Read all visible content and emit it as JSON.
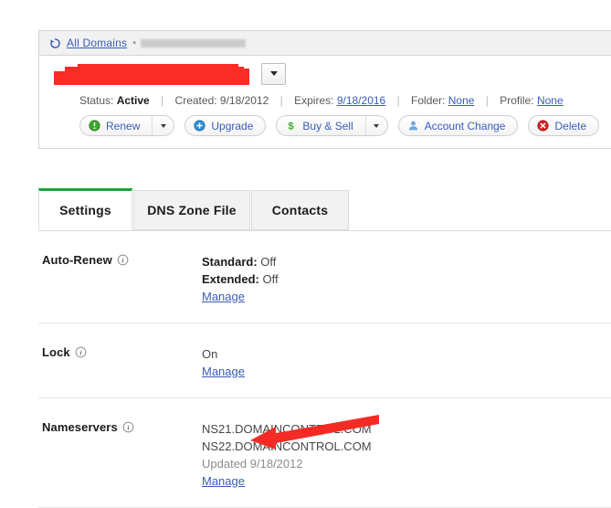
{
  "breadcrumb": {
    "refresh_icon": "refresh-icon",
    "all_domains_label": "All Domains",
    "separator": "▪",
    "current_domain": "[redacted]"
  },
  "domain_header": {
    "domain_name": "[redacted]",
    "dropdown_icon": "chevron-down-icon"
  },
  "status": {
    "status_key": "Status:",
    "status_value": "Active",
    "created_key": "Created:",
    "created_value": "9/18/2012",
    "expires_key": "Expires:",
    "expires_value": "9/18/2016",
    "folder_key": "Folder:",
    "folder_value": "None",
    "profile_key": "Profile:",
    "profile_value": "None",
    "separator": "|"
  },
  "actions": {
    "renew_label": "Renew",
    "renew_icon": "exclamation-circle-icon",
    "renew_caret_icon": "chevron-down-icon",
    "upgrade_label": "Upgrade",
    "upgrade_icon": "plus-circle-icon",
    "buy_sell_label": "Buy & Sell",
    "buy_sell_icon": "dollar-sign-icon",
    "buy_sell_caret_icon": "chevron-down-icon",
    "account_change_label": "Account Change",
    "account_change_icon": "user-icon",
    "delete_label": "Delete",
    "delete_icon": "close-circle-icon"
  },
  "tabs": [
    {
      "label": "Settings",
      "active": true
    },
    {
      "label": "DNS Zone File",
      "active": false
    },
    {
      "label": "Contacts",
      "active": false
    }
  ],
  "settings_rows": {
    "auto_renew": {
      "label": "Auto-Renew",
      "info_icon": "info-icon",
      "standard_key": "Standard:",
      "standard_value": "Off",
      "extended_key": "Extended:",
      "extended_value": "Off",
      "manage_label": "Manage"
    },
    "lock": {
      "label": "Lock",
      "info_icon": "info-icon",
      "value": "On",
      "manage_label": "Manage"
    },
    "nameservers": {
      "label": "Nameservers",
      "info_icon": "info-icon",
      "ns1": "NS21.DOMAINCONTROL.COM",
      "ns2": "NS22.DOMAINCONTROL.COM",
      "updated": "Updated 9/18/2012",
      "manage_label": "Manage"
    }
  },
  "annotation": {
    "arrow_icon": "red-arrow-pointing-left",
    "arrow_color": "#f42b24",
    "points_at": "Manage"
  },
  "colors": {
    "accent_green": "#1aa33b",
    "link_blue": "#3b5cb8",
    "redaction_red": "#fb2b25",
    "panel_border": "#d4d4d4",
    "tab_inactive_bg": "#f2f2f2"
  }
}
